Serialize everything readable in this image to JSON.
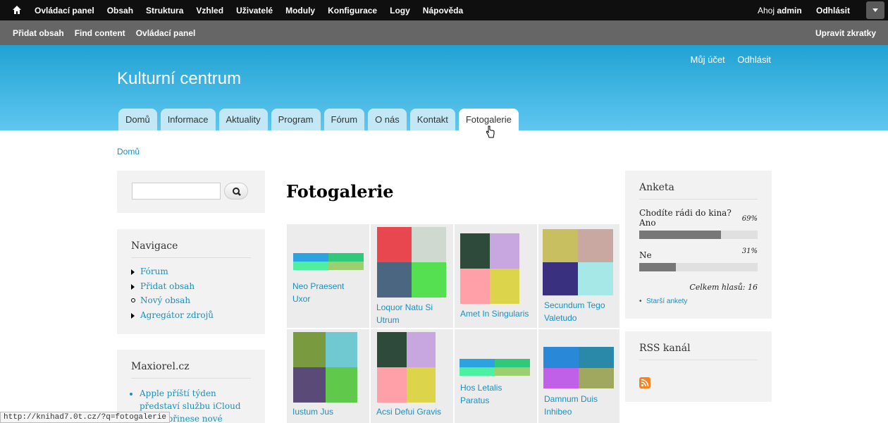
{
  "admin_bar": {
    "menu": [
      "Ovládací panel",
      "Obsah",
      "Struktura",
      "Vzhled",
      "Uživatelé",
      "Moduly",
      "Konfigurace",
      "Logy",
      "Nápověda"
    ],
    "hello": "Ahoj",
    "user": "admin",
    "logout": "Odhlásit"
  },
  "shortcuts": {
    "links": [
      "Přidat obsah",
      "Find content",
      "Ovládací panel"
    ],
    "edit": "Upravit zkratky"
  },
  "header": {
    "site_name": "Kulturní centrum",
    "secondary": [
      "Můj účet",
      "Odhlásit"
    ],
    "tabs": [
      "Domů",
      "Informace",
      "Aktuality",
      "Program",
      "Fórum",
      "O nás",
      "Kontakt",
      "Fotogalerie"
    ],
    "active_tab": "Fotogalerie"
  },
  "breadcrumb": "Domů",
  "navigation": {
    "title": "Navigace",
    "items": [
      "Fórum",
      "Přidat obsah",
      "Nový obsah",
      "Agregátor zdrojů"
    ]
  },
  "maxiorel": {
    "title": "Maxiorel.cz",
    "items": [
      "Apple příští týden představí službu iCloud",
      "Gmail přinese nové"
    ]
  },
  "page_title": "Fotogalerie",
  "gallery": [
    {
      "caption": "Neo Praesent Uxor",
      "colors": [
        "#2ba3e0",
        "#2ec97a",
        "#4cf0a0",
        "#9ccf70"
      ]
    },
    {
      "caption": "Loquor Natu Si Utrum",
      "colors": [
        "#e8474f",
        "#cfd9d0",
        "#4a6680",
        "#54e050"
      ]
    },
    {
      "caption": "Amet In Singularis",
      "colors": [
        "#2e4a3a",
        "#c8a6e0",
        "#ff9fa8",
        "#dcd44a"
      ]
    },
    {
      "caption": "Secundum Tego Valetudo",
      "colors": [
        "#c8c060",
        "#c8a8a0",
        "#3a3080",
        "#a6e8e8"
      ]
    },
    {
      "caption": "Iustum Jus",
      "colors": [
        "#7a9a40",
        "#70c8d0",
        "#5a4a78",
        "#60c84a"
      ]
    },
    {
      "caption": "Acsi Defui Gravis",
      "colors": [
        "#2e4a3a",
        "#c8a6e0",
        "#ff9fa8",
        "#dcd44a"
      ]
    },
    {
      "caption": "Hos Letalis Paratus",
      "colors": [
        "#2ba3e0",
        "#2ec97a",
        "#4cf0a0",
        "#9ccf70"
      ]
    },
    {
      "caption": "Damnum Duis Inhibeo",
      "colors": [
        "#2a88d8",
        "#2a88a8",
        "#c060e8",
        "#a0a860"
      ]
    }
  ],
  "poll": {
    "title": "Anketa",
    "question": "Chodíte rádi do kina?",
    "options": [
      {
        "label": "Ano",
        "percent": 69
      },
      {
        "label": "Ne",
        "percent": 31
      }
    ],
    "total": "Celkem hlasů: 16",
    "older": "Starší ankety"
  },
  "rss": {
    "title": "RSS kanál"
  },
  "status_url": "http://knihad7.0t.cz/?q=fotogalerie"
}
